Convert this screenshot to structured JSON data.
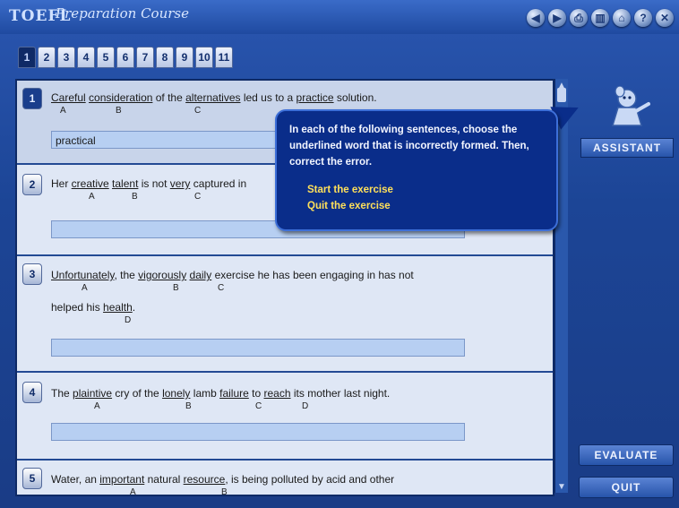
{
  "header": {
    "logo": "TOEFL",
    "title": "Preparation Course"
  },
  "toolbar_icons": [
    "prev-icon",
    "next-icon",
    "print-icon",
    "chart-icon",
    "home-icon",
    "help-icon",
    "close-icon"
  ],
  "tabs": [
    "1",
    "2",
    "3",
    "4",
    "5",
    "6",
    "7",
    "8",
    "9",
    "10",
    "11"
  ],
  "questions": [
    {
      "num": "1",
      "sentence_parts": [
        "Careful",
        " ",
        "consideration",
        " of the ",
        "alternatives",
        " led us to a ",
        "practice",
        " solution."
      ],
      "letters": [
        "A",
        "B",
        "C"
      ],
      "answer": "practical"
    },
    {
      "num": "2",
      "sentence_parts": [
        "Her ",
        "creative",
        " ",
        "talent",
        " is not ",
        "very",
        " captured in"
      ],
      "letters": [
        "A",
        "B",
        "C"
      ],
      "answer": ""
    },
    {
      "num": "3",
      "sentence_parts": [
        "Unfortunately",
        ", the ",
        "vigorously",
        " ",
        "daily",
        " exercise he has been engaging in has not"
      ],
      "line2": [
        "helped his ",
        "health",
        "."
      ],
      "letters": [
        "A",
        "B",
        "C",
        "D"
      ],
      "answer": ""
    },
    {
      "num": "4",
      "sentence_parts": [
        "The ",
        "plaintive",
        " cry of the ",
        "lonely",
        " lamb ",
        "failure",
        " to ",
        "reach",
        " its mother last night."
      ],
      "letters": [
        "A",
        "B",
        "C",
        "D"
      ],
      "answer": ""
    },
    {
      "num": "5",
      "sentence_parts": [
        "Water, an ",
        "important",
        " natural ",
        "resource",
        ", is being polluted by acid and other"
      ],
      "letters": [
        "A",
        "B"
      ],
      "answer": ""
    }
  ],
  "assistant": {
    "label": "ASSISTANT",
    "message": "In each of the following sentences, choose the underlined word that is incorrectly formed. Then, correct the error.",
    "start_link": "Start the exercise",
    "quit_link": "Quit the exercise"
  },
  "buttons": {
    "evaluate": "EVALUATE",
    "quit": "QUIT"
  },
  "colors": {
    "frame": "#1a3f8a",
    "panel": "#dfe7f5",
    "answer_field": "#b7cff2",
    "popup": "#0a2d8a",
    "link": "#ffe05a"
  }
}
